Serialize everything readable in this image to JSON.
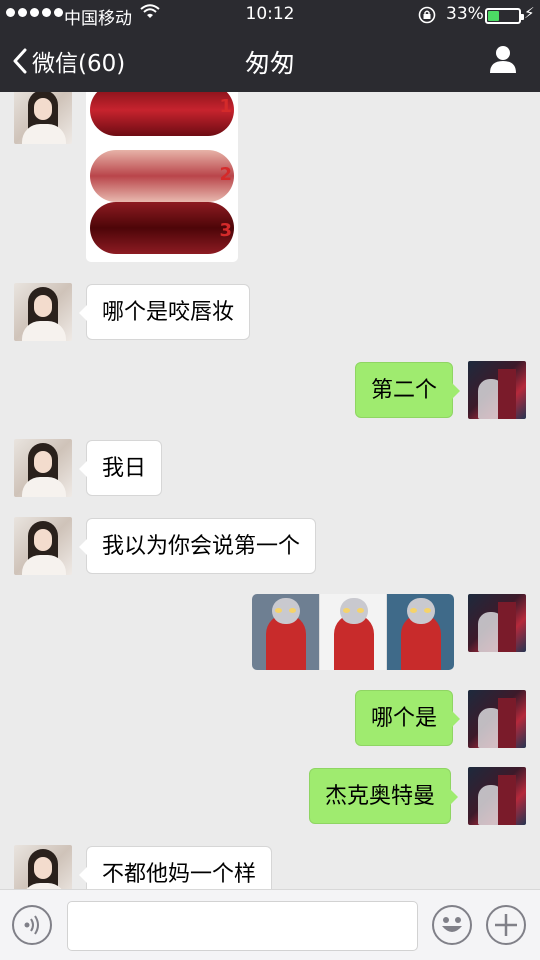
{
  "status_bar": {
    "carrier": "中国移动",
    "time": "10:12",
    "battery_percent": "33%",
    "battery_level": 0.33
  },
  "nav": {
    "back_label": "微信(60)",
    "title": "匆匆"
  },
  "lip_labels": [
    "1",
    "2",
    "3"
  ],
  "messages": [
    {
      "side": "in",
      "type": "image",
      "content": "lip-photos"
    },
    {
      "side": "in",
      "type": "text",
      "text": "哪个是咬唇妆"
    },
    {
      "side": "out",
      "type": "text",
      "text": "第二个"
    },
    {
      "side": "in",
      "type": "text",
      "text": "我日"
    },
    {
      "side": "in",
      "type": "text",
      "text": "我以为你会说第一个"
    },
    {
      "side": "out",
      "type": "image",
      "content": "ultraman-photos"
    },
    {
      "side": "out",
      "type": "text",
      "text": "哪个是"
    },
    {
      "side": "out",
      "type": "text",
      "text": "杰克奥特曼"
    },
    {
      "side": "in",
      "type": "text",
      "text": "不都他妈一个样"
    }
  ],
  "icons": {
    "back": "chevron-left-icon",
    "profile": "person-icon",
    "voice": "voice-icon",
    "emoji": "emoji-icon",
    "plus": "plus-icon"
  },
  "colors": {
    "header_bg": "#2b2b30",
    "chat_bg": "#ebebeb",
    "outgoing_bubble": "#9feb6f",
    "incoming_bubble": "#ffffff",
    "battery_fill": "#4cd964"
  }
}
